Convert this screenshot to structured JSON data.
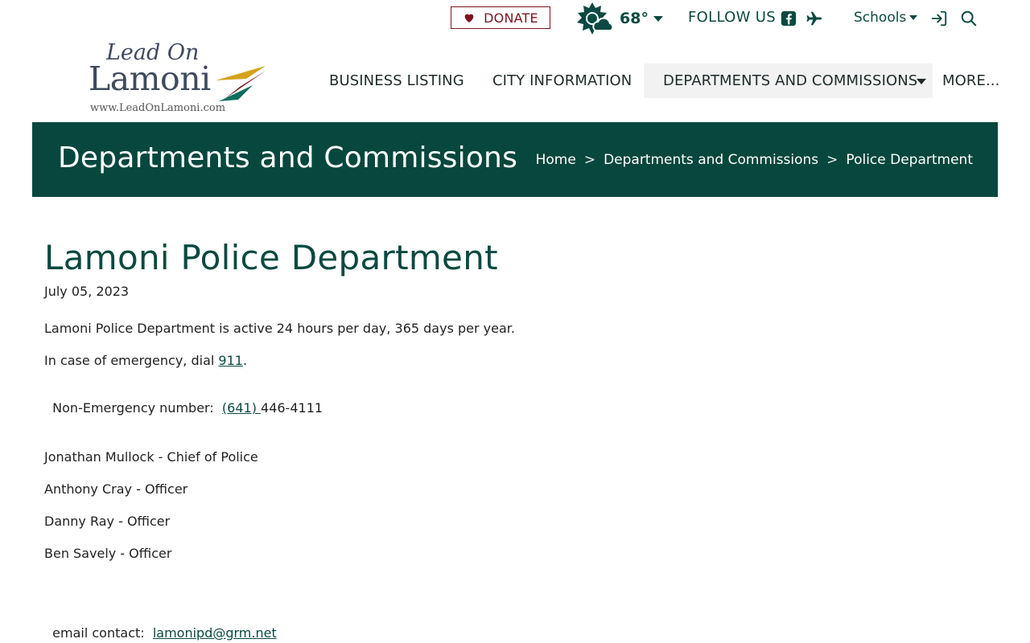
{
  "topbar": {
    "donate_label": "DONATE",
    "temperature": "68°",
    "follow_label": "FOLLOW US",
    "schools_label": "Schools"
  },
  "logo": {
    "line1": "Lead On",
    "line2": "Lamoni",
    "url": "www.LeadOnLamoni.com"
  },
  "nav": {
    "items": [
      {
        "label": "BUSINESS LISTING"
      },
      {
        "label": "CITY INFORMATION"
      },
      {
        "label": "DEPARTMENTS AND COMMISSIONS"
      },
      {
        "label": "MORE..."
      }
    ]
  },
  "banner": {
    "title": "Departments and Commissions",
    "breadcrumb": [
      "Home",
      "Departments and Commissions",
      "Police Department"
    ],
    "sep": ">"
  },
  "content": {
    "title": "Lamoni Police Department",
    "date": "July 05, 2023",
    "active_text": "Lamoni Police Department is active 24 hours per day, 365 days per year.",
    "emergency_prefix": "In case of emergency, dial ",
    "emergency_number": "911",
    "emergency_suffix": ".",
    "nonemergency_prefix": "Non-Emergency number:  ",
    "nonemergency_area": "(641) ",
    "nonemergency_rest": "446-4111",
    "staff": [
      "Jonathan Mullock - Chief of Police",
      "Anthony Cray - Officer",
      "Danny Ray - Officer",
      "Ben Savely - Officer"
    ],
    "email_prefix": "email contact:  ",
    "email": "lamonipd@grm.net"
  },
  "colors": {
    "brand_green": "#08473d",
    "donate_red": "#7a1420",
    "logo_gold": "#d4a21c",
    "logo_maroon": "#7a1420",
    "logo_teal": "#0f6e5e"
  }
}
